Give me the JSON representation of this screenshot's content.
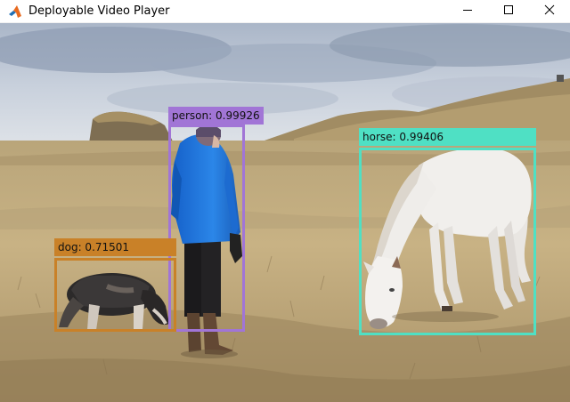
{
  "window": {
    "title": "Deployable Video Player",
    "controls": {
      "minimize_icon": "minimize-icon",
      "maximize_icon": "maximize-icon",
      "close_icon": "close-icon"
    }
  },
  "detections": [
    {
      "label": "person: 0.99926",
      "color": "#a175d6"
    },
    {
      "label": "dog: 0.71501",
      "color": "#c98128"
    },
    {
      "label": "horse: 0.99406",
      "color": "#4fe0c4"
    }
  ]
}
